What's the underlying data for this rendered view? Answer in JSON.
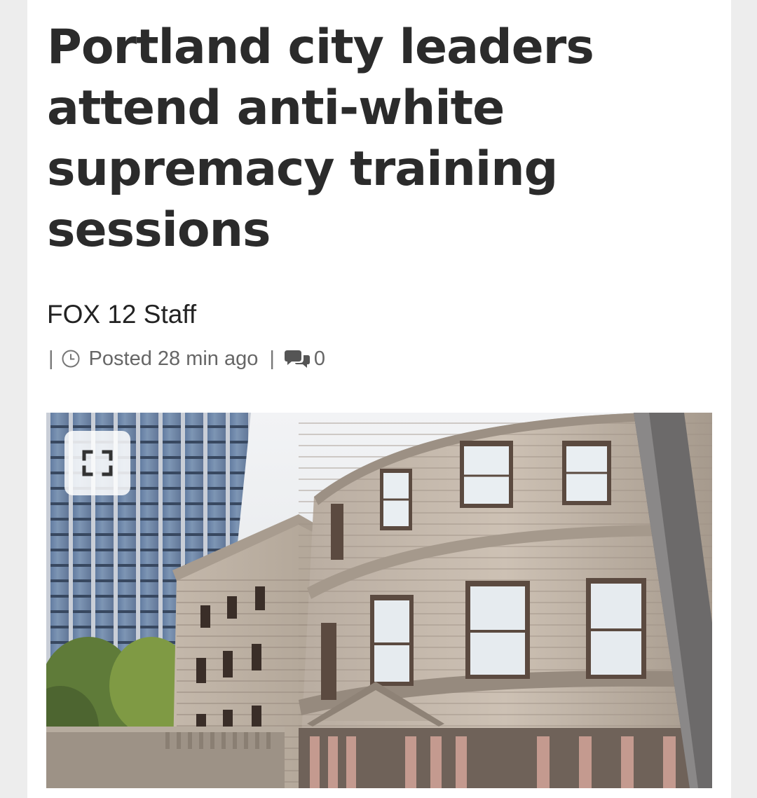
{
  "article": {
    "headline": "Portland city leaders attend anti-white supremacy training sessions",
    "author": "FOX 12 Staff",
    "posted": "Posted 28 min ago",
    "comment_count": "0"
  },
  "icons": {
    "posted": "clock-icon",
    "comments": "comment-bubbles-icon",
    "expand": "expand-fullscreen-icon"
  },
  "colors": {
    "headline": "#2b2b2b",
    "meta": "#666666",
    "page_background": "#ededed"
  }
}
